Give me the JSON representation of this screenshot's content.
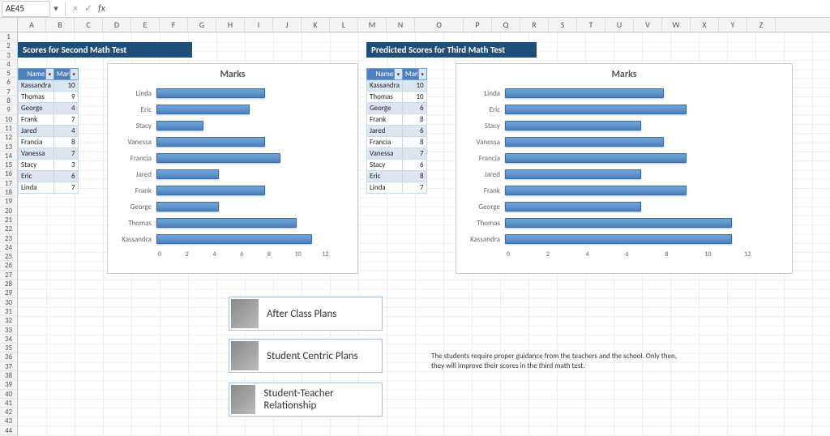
{
  "formula_bar": {
    "name_box": "AE45",
    "fx_label": "fx",
    "cancel": "×",
    "confirm": "✓",
    "formula": ""
  },
  "columns": [
    "A",
    "B",
    "C",
    "D",
    "E",
    "F",
    "G",
    "H",
    "I",
    "J",
    "K",
    "L",
    "M",
    "N",
    "O",
    "P",
    "Q",
    "R",
    "S",
    "T",
    "U",
    "V",
    "W",
    "X",
    "Y",
    "Z"
  ],
  "banners": {
    "left": "Scores for Second Math Test",
    "right": "Predicted Scores for Third Math Test"
  },
  "table_headers": {
    "name": "Name",
    "marks": "Marks"
  },
  "left_table": [
    {
      "name": "Kassandra",
      "marks": 10
    },
    {
      "name": "Thomas",
      "marks": 9
    },
    {
      "name": "George",
      "marks": 4
    },
    {
      "name": "Frank",
      "marks": 7
    },
    {
      "name": "Jared",
      "marks": 4
    },
    {
      "name": "Francia",
      "marks": 8
    },
    {
      "name": "Vanessa",
      "marks": 7
    },
    {
      "name": "Stacy",
      "marks": 3
    },
    {
      "name": "Eric",
      "marks": 6
    },
    {
      "name": "Linda",
      "marks": 7
    }
  ],
  "right_table": [
    {
      "name": "Kassandra",
      "marks": 10
    },
    {
      "name": "Thomas",
      "marks": 10
    },
    {
      "name": "George",
      "marks": 6
    },
    {
      "name": "Frank",
      "marks": 8
    },
    {
      "name": "Jared",
      "marks": 6
    },
    {
      "name": "Francia",
      "marks": 8
    },
    {
      "name": "Vanessa",
      "marks": 7
    },
    {
      "name": "Stacy",
      "marks": 6
    },
    {
      "name": "Eric",
      "marks": 8
    },
    {
      "name": "Linda",
      "marks": 7
    }
  ],
  "chart_data": [
    {
      "type": "bar",
      "orientation": "horizontal",
      "title": "Marks",
      "categories": [
        "Linda",
        "Eric",
        "Stacy",
        "Vanessa",
        "Francia",
        "Jared",
        "Frank",
        "George",
        "Thomas",
        "Kassandra"
      ],
      "values": [
        7,
        6,
        3,
        7,
        8,
        4,
        7,
        4,
        9,
        10
      ],
      "xlim": [
        0,
        12
      ],
      "xticks": [
        0,
        2,
        4,
        6,
        8,
        10,
        12
      ]
    },
    {
      "type": "bar",
      "orientation": "horizontal",
      "title": "Marks",
      "categories": [
        "Linda",
        "Eric",
        "Stacy",
        "Vanessa",
        "Francia",
        "Jared",
        "Frank",
        "George",
        "Thomas",
        "Kassandra"
      ],
      "values": [
        7,
        8,
        6,
        7,
        8,
        6,
        8,
        6,
        10,
        10
      ],
      "xlim": [
        0,
        12
      ],
      "xticks": [
        0,
        2,
        4,
        6,
        8,
        10,
        12
      ]
    }
  ],
  "cards": [
    {
      "label": "After Class Plans"
    },
    {
      "label": "Student Centric Plans"
    },
    {
      "label": "Student-Teacher Relationship"
    }
  ],
  "note_text": "The students require proper guidance from the teachers and the school. Only then, they will improve their scores in the third math test."
}
